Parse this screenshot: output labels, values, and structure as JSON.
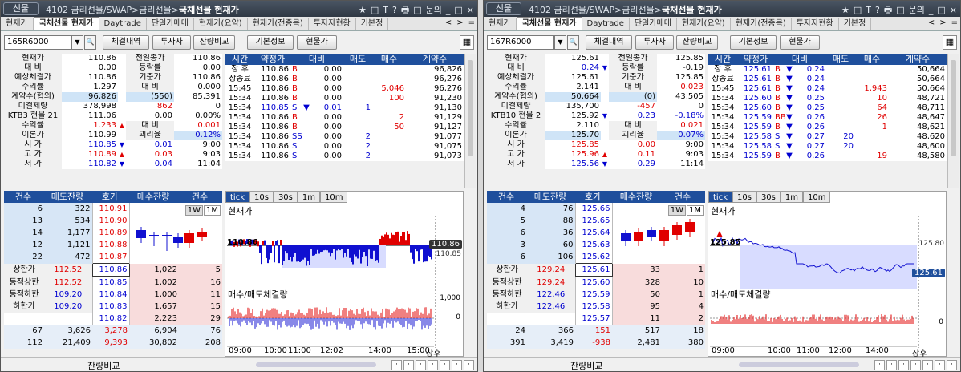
{
  "windows": [
    {
      "badge": "선물",
      "title_path": "4102 금리선물/SWAP>금리선물>",
      "title_main": "국채선물 현재가",
      "title_icons": [
        "★",
        "□",
        "T",
        "?",
        "🖶",
        "□",
        "문의",
        "_",
        "□",
        "×"
      ],
      "tabs": [
        "현재가",
        "국채선물 현재가",
        "Daytrade",
        "단일가매매",
        "현재가(요약)",
        "현재가(전종목)",
        "투자자현황",
        "기본정"
      ],
      "tab_nav": [
        "<",
        ">",
        "="
      ],
      "code": "165R6000",
      "buttons": [
        "체결내역",
        "투자자",
        "잔량비교",
        "기본정보",
        "현물가"
      ],
      "info": [
        [
          "현재가",
          "110.86",
          "",
          "전일종가",
          "110.86"
        ],
        [
          "대   비",
          "0.00",
          "",
          "등락률",
          "0.00"
        ],
        [
          "예상체결가",
          "110.86",
          "",
          "기준가",
          "110.86"
        ],
        [
          "수익률",
          "1.297",
          "",
          "대   비",
          "0.000"
        ],
        [
          "계약수(협의)",
          "96,826",
          "",
          "(550)",
          "85,391"
        ],
        [
          "미결제량",
          "378,998",
          "",
          "862",
          "0"
        ],
        [
          "KTB3 현물 21",
          "111.06",
          "",
          "0.00",
          "0.00%"
        ],
        [
          "수익률",
          "1.233",
          "▲",
          "대   비",
          "0.001"
        ],
        [
          "이론가",
          "110.99",
          "",
          "괴리율",
          "0.12%"
        ],
        [
          "시   가",
          "110.85",
          "▼",
          "0.01",
          "9:00"
        ],
        [
          "고   가",
          "110.89",
          "▲",
          "0.03",
          "9:03"
        ],
        [
          "저   가",
          "110.82",
          "▼",
          "0.04",
          "11:04"
        ]
      ],
      "tick_headers": [
        "시간",
        "약정가",
        "대비",
        "매도",
        "매수",
        "계약수"
      ],
      "ticks": [
        [
          "장 후",
          "110.86",
          "B",
          "",
          "0.00",
          "",
          "",
          "96,826"
        ],
        [
          "장종료",
          "110.86",
          "B",
          "",
          "0.00",
          "",
          "",
          "96,276"
        ],
        [
          "15:45",
          "110.86",
          "B",
          "",
          "0.00",
          "",
          "5,046",
          "96,276"
        ],
        [
          "15:34",
          "110.86",
          "B",
          "",
          "0.00",
          "",
          "100",
          "91,230"
        ],
        [
          "15:34",
          "110.85",
          "S",
          "▼",
          "0.01",
          "1",
          "",
          "91,130"
        ],
        [
          "15:34",
          "110.86",
          "B",
          "",
          "0.00",
          "",
          "2",
          "91,129"
        ],
        [
          "15:34",
          "110.86",
          "B",
          "",
          "0.00",
          "",
          "50",
          "91,127"
        ],
        [
          "15:34",
          "110.86",
          "SS",
          "",
          "0.00",
          "2",
          "",
          "91,077"
        ],
        [
          "15:34",
          "110.86",
          "S",
          "",
          "0.00",
          "2",
          "",
          "91,075"
        ],
        [
          "15:34",
          "110.86",
          "S",
          "",
          "0.00",
          "2",
          "",
          "91,073"
        ]
      ],
      "ob_headers": [
        "건수",
        "매도잔량",
        "호가",
        "매수잔량",
        "건수"
      ],
      "asks": [
        [
          "6",
          "322",
          "110.91"
        ],
        [
          "13",
          "534",
          "110.90"
        ],
        [
          "14",
          "1,177",
          "110.89"
        ],
        [
          "12",
          "1,121",
          "110.88"
        ],
        [
          "22",
          "472",
          "110.87"
        ]
      ],
      "bids": [
        [
          "110.86",
          "1,022",
          "5"
        ],
        [
          "110.85",
          "1,002",
          "16"
        ],
        [
          "110.84",
          "1,000",
          "11"
        ],
        [
          "110.83",
          "1,657",
          "15"
        ],
        [
          "110.82",
          "2,223",
          "29"
        ]
      ],
      "limits": [
        [
          "상한가",
          "112.52"
        ],
        [
          "동적상한",
          "112.52"
        ],
        [
          "동적하한",
          "109.20"
        ],
        [
          "하한가",
          "109.20"
        ]
      ],
      "totals": [
        [
          "67",
          "3,626",
          "3,278",
          "6,904",
          "76"
        ],
        [
          "112",
          "21,409",
          "9,393",
          "30,802",
          "208"
        ]
      ],
      "chart_tabs": [
        "tick",
        "10s",
        "30s",
        "1m",
        "10m"
      ],
      "period": [
        "1W",
        "1M"
      ],
      "chart_title": "현재가",
      "vol_title": "매수/매도체결량",
      "price_mark": "110.86",
      "price_badge": "110.86",
      "price_badge2": "110.85",
      "vol_ticks": [
        "1,000",
        "0"
      ],
      "time_labels": [
        "09:00",
        "10:00",
        "11:00",
        "12:02",
        "14:00",
        "15:00",
        "장후"
      ],
      "status_label": "잔량비교"
    },
    {
      "badge": "선물",
      "title_path": "4102 금리선물/SWAP>금리선물>",
      "title_main": "국채선물 현재가",
      "title_icons": [
        "★",
        "□",
        "T",
        "?",
        "🖶",
        "□",
        "문의",
        "_",
        "□",
        "×"
      ],
      "tabs": [
        "현재가",
        "국채선물 현재가",
        "Daytrade",
        "단일가매매",
        "현재가(요약)",
        "현재가(전종목)",
        "투자자현황",
        "기본정"
      ],
      "tab_nav": [
        "<",
        ">",
        "="
      ],
      "code": "167R6000",
      "buttons": [
        "체결내역",
        "투자자",
        "잔량비교",
        "기본정보",
        "현물가"
      ],
      "info": [
        [
          "현재가",
          "125.61",
          "",
          "전일종가",
          "125.85"
        ],
        [
          "대   비",
          "0.24",
          "▼",
          "등락률",
          "-0.19"
        ],
        [
          "예상체결가",
          "125.61",
          "",
          "기준가",
          "125.85"
        ],
        [
          "수익률",
          "2.141",
          "",
          "대   비",
          "0.023"
        ],
        [
          "계약수(협의)",
          "50,664",
          "",
          "(0)",
          "43,505"
        ],
        [
          "미결제량",
          "135,700",
          "",
          "-457",
          "0"
        ],
        [
          "KTB10 현물 2",
          "125.92",
          "▼",
          "0.23",
          "-0.18%"
        ],
        [
          "수익률",
          "2.110",
          "",
          "대   비",
          "0.021"
        ],
        [
          "이론가",
          "125.70",
          "",
          "괴리율",
          "0.07%"
        ],
        [
          "시   가",
          "125.85",
          "",
          "0.00",
          "9:00"
        ],
        [
          "고   가",
          "125.96",
          "▲",
          "0.11",
          "9:03"
        ],
        [
          "저   가",
          "125.56",
          "▼",
          "0.29",
          "11:14"
        ]
      ],
      "tick_headers": [
        "시간",
        "약정가",
        "대비",
        "매도",
        "매수",
        "계약수"
      ],
      "ticks": [
        [
          "장 후",
          "125.61",
          "B",
          "▼",
          "0.24",
          "",
          "",
          "50,664"
        ],
        [
          "장종료",
          "125.61",
          "B",
          "▼",
          "0.24",
          "",
          "",
          "50,664"
        ],
        [
          "15:45",
          "125.61",
          "B",
          "▼",
          "0.24",
          "",
          "1,943",
          "50,664"
        ],
        [
          "15:34",
          "125.60",
          "B",
          "▼",
          "0.25",
          "",
          "10",
          "48,721"
        ],
        [
          "15:34",
          "125.60",
          "B",
          "▼",
          "0.25",
          "",
          "64",
          "48,711"
        ],
        [
          "15:34",
          "125.59",
          "BB",
          "▼",
          "0.26",
          "",
          "26",
          "48,647"
        ],
        [
          "15:34",
          "125.59",
          "B",
          "▼",
          "0.26",
          "",
          "1",
          "48,621"
        ],
        [
          "15:34",
          "125.58",
          "S",
          "▼",
          "0.27",
          "20",
          "",
          "48,620"
        ],
        [
          "15:34",
          "125.58",
          "S",
          "▼",
          "0.27",
          "20",
          "",
          "48,600"
        ],
        [
          "15:34",
          "125.59",
          "B",
          "▼",
          "0.26",
          "",
          "19",
          "48,580"
        ]
      ],
      "ob_headers": [
        "건수",
        "매도잔량",
        "호가",
        "매수잔량",
        "건수"
      ],
      "asks": [
        [
          "4",
          "76",
          "125.66"
        ],
        [
          "5",
          "88",
          "125.65"
        ],
        [
          "6",
          "36",
          "125.64"
        ],
        [
          "3",
          "60",
          "125.63"
        ],
        [
          "6",
          "106",
          "125.62"
        ]
      ],
      "bids": [
        [
          "125.61",
          "33",
          "1"
        ],
        [
          "125.60",
          "328",
          "10"
        ],
        [
          "125.59",
          "50",
          "1"
        ],
        [
          "125.58",
          "95",
          "4"
        ],
        [
          "125.57",
          "11",
          "2"
        ]
      ],
      "limits": [
        [
          "상한가",
          "129.24"
        ],
        [
          "동적상한",
          "129.24"
        ],
        [
          "동적하한",
          "122.46"
        ],
        [
          "하한가",
          "122.46"
        ]
      ],
      "totals": [
        [
          "24",
          "366",
          "151",
          "517",
          "18"
        ],
        [
          "391",
          "3,419",
          "-938",
          "2,481",
          "380"
        ]
      ],
      "chart_tabs": [
        "tick",
        "10s",
        "30s",
        "1m",
        "10m"
      ],
      "period": [
        "1W",
        "1M"
      ],
      "chart_title": "현재가",
      "vol_title": "매수/매도체결량",
      "price_mark": "125.85",
      "price_badge": "125.61",
      "price_badge2": "125.80",
      "vol_ticks": [
        "0"
      ],
      "time_labels": [
        "09:00",
        "10:00",
        "11:00",
        "12:00",
        "14:00",
        "장후"
      ],
      "status_label": "잔량비교"
    }
  ],
  "colors": {
    "header_blue": "#1f4f9c",
    "up": "#e00000",
    "down": "#0000d0",
    "ask_bg": "#d7e6f6",
    "bid_bg": "#f8dcdc"
  }
}
